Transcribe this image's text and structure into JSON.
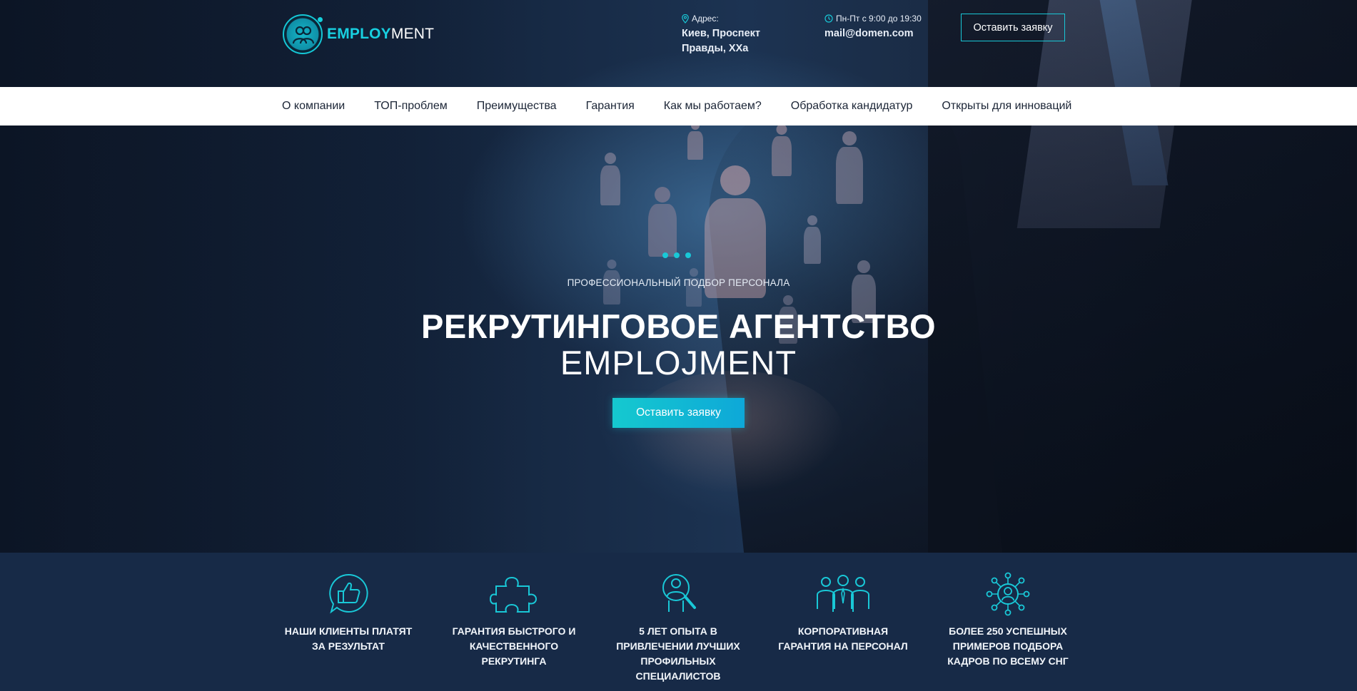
{
  "brand": {
    "logo_accent": "EMPLOY",
    "logo_rest": "MENT",
    "accent_color": "#19c8d7"
  },
  "header": {
    "address_label": "Адрес:",
    "address_value": "Киев, Проспект Правды, XXa",
    "hours_label": "Пн-Пт с 9:00 до 19:30",
    "email": "mail@domen.com",
    "cta_label": "Оставить заявку"
  },
  "nav": {
    "items": [
      {
        "label": "О компании"
      },
      {
        "label": "ТОП-проблем"
      },
      {
        "label": "Преимущества"
      },
      {
        "label": "Гарантия"
      },
      {
        "label": "Как мы работаем?"
      },
      {
        "label": "Обработка кандидатур"
      },
      {
        "label": "Открыты для инноваций"
      }
    ]
  },
  "hero": {
    "kicker": "ПРОФЕССИОНАЛЬНЫЙ ПОДБОР ПЕРСОНАЛА",
    "title_line1": "РЕКРУТИНГОВОЕ АГЕНТСТВО",
    "title_line2": "EMPLOJMENT",
    "cta_label": "Оставить заявку"
  },
  "features": [
    {
      "icon": "thumbs-up-chat-icon",
      "text": "НАШИ КЛИЕНТЫ ПЛАТЯТ ЗА РЕЗУЛЬТАТ"
    },
    {
      "icon": "puzzle-icon",
      "text": "ГАРАНТИЯ БЫСТРОГО И КАЧЕСТВЕННОГО РЕКРУТИНГА"
    },
    {
      "icon": "person-search-icon",
      "text": "5 ЛЕТ ОПЫТА В ПРИВЛЕЧЕНИИ ЛУЧШИХ ПРОФИЛЬНЫХ СПЕЦИАЛИСТОВ"
    },
    {
      "icon": "team-icon",
      "text": "КОРПОРАТИВНАЯ ГАРАНТИЯ НА ПЕРСОНАЛ"
    },
    {
      "icon": "network-person-icon",
      "text": "БОЛЕЕ 250 УСПЕШНЫХ ПРИМЕРОВ ПОДБОРА КАДРОВ ПО ВСЕМУ СНГ"
    }
  ]
}
